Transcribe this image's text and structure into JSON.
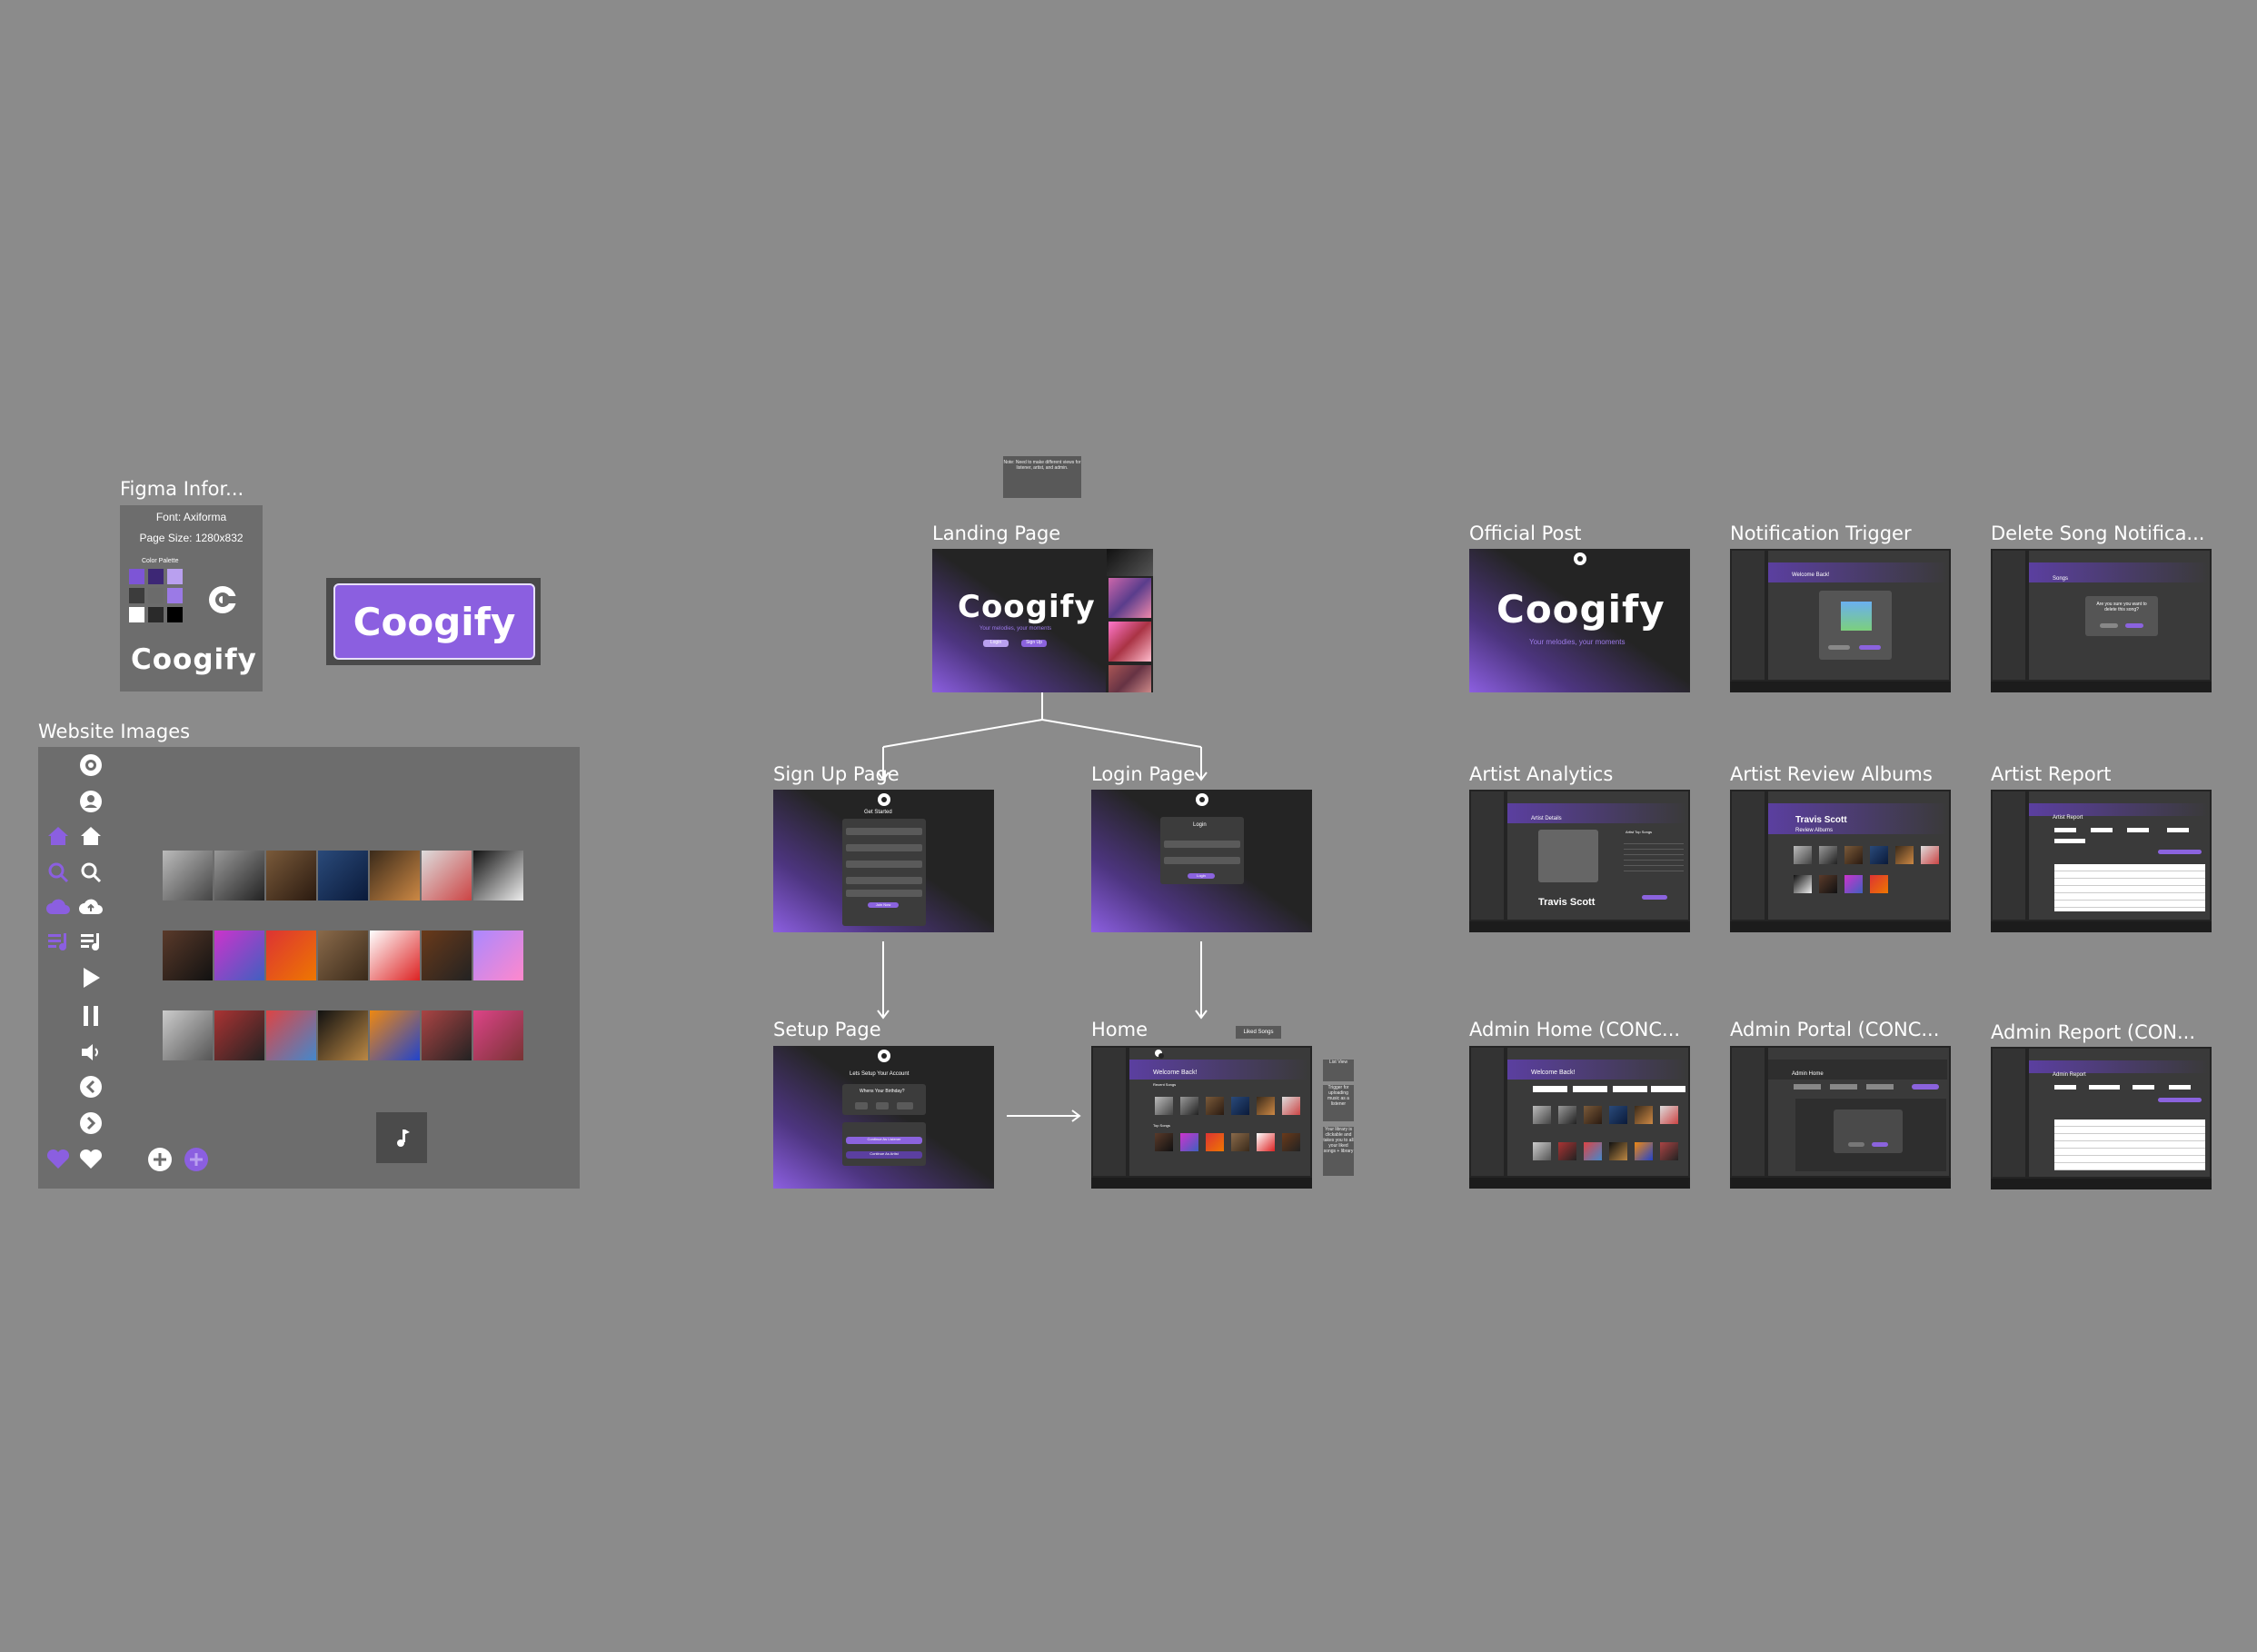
{
  "figma_info": {
    "title": "Figma Infor...",
    "font": "Font: Axiforma",
    "page_size": "Page Size: 1280x832",
    "color_palette_label": "Color Palette",
    "colors": [
      "#7d55d6",
      "#3d2775",
      "#b9a0ef",
      "#3c3c3c",
      "#6b6b6b",
      "#9b7ae6",
      "#ffffff",
      "#2a2a2a",
      "#000000"
    ],
    "wordmark": "Coogify"
  },
  "logo_button": {
    "label": "Coogify"
  },
  "website_images": {
    "title": "Website Images"
  },
  "note": {
    "text": "Note: Need to make different views for listener, artist, and admin."
  },
  "frames": {
    "landing": {
      "title": "Landing Page",
      "wordmark": "Coogify",
      "tagline": "Your melodies, your moments",
      "login": "Login",
      "signup": "Sign Up"
    },
    "signup": {
      "title": "Sign Up Page",
      "heading": "Get Started",
      "button": "Join Now"
    },
    "login": {
      "title": "Login Page",
      "heading": "Login",
      "button": "Login"
    },
    "setup": {
      "title": "Setup Page",
      "heading": "Lets Setup Your Account",
      "question": "Whens Your Birthday?",
      "btn_listener": "Continue As Listener",
      "btn_artist": "Continue As Artist"
    },
    "home": {
      "title": "Home",
      "welcome": "Welcome Back!",
      "recent": "Recent Songs",
      "top": "Top Songs",
      "liked_tag": "Liked Songs"
    },
    "official": {
      "title": "Official Post",
      "wordmark": "Coogify",
      "tagline": "Your melodies, your moments"
    },
    "notification": {
      "title": "Notification Trigger",
      "welcome": "Welcome Back!"
    },
    "delete_song": {
      "title": "Delete Song Notifica...",
      "header": "Songs",
      "prompt": "Are you sure you want to delete this song?"
    },
    "artist_analytics": {
      "title": "Artist Analytics",
      "header": "Artist Details",
      "artist": "Travis Scott",
      "top_songs": "Artist Top Songs"
    },
    "artist_review": {
      "title": "Artist Review Albums",
      "artist": "Travis Scott",
      "sub": "Review Albums"
    },
    "artist_report": {
      "title": "Artist Report",
      "header": "Artist Report"
    },
    "admin_home": {
      "title": "Admin Home (CONC...",
      "welcome": "Welcome Back!"
    },
    "admin_portal": {
      "title": "Admin Portal (CONC...",
      "header": "Admin Home"
    },
    "admin_report": {
      "title": "Admin Report (CON...",
      "header": "Admin Report"
    }
  },
  "side_notes": {
    "list_view": "List View",
    "trigger": "Trigger for uploading music as a listener",
    "library": "Your library is clickable and takes you to all your liked songs + library"
  }
}
